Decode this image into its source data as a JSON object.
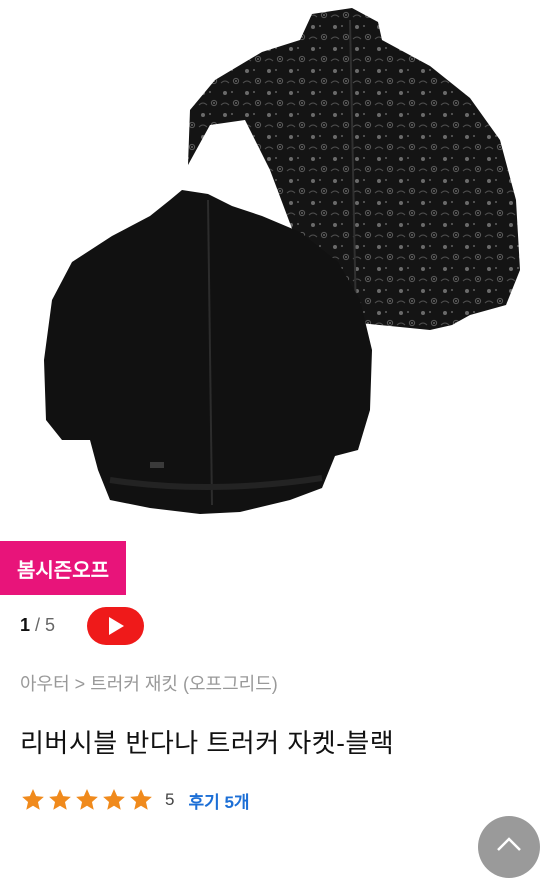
{
  "badge": {
    "label": "봄시즌오프",
    "color": "#e8147a"
  },
  "image_counter": {
    "current": "1",
    "separator": " / ",
    "total": "5"
  },
  "video_button": {
    "icon": "play-icon",
    "color": "#ef1a1a"
  },
  "breadcrumb": {
    "text": "아우터 > 트러커 재킷 (오프그리드)"
  },
  "product": {
    "title": "리버시블 반다나 트러커 자켓-블랙"
  },
  "rating": {
    "stars": 5,
    "score": "5",
    "reviews_label": "후기 5개",
    "star_color": "#f08a1c"
  },
  "scroll_top": {
    "icon": "chevron-up-icon"
  }
}
